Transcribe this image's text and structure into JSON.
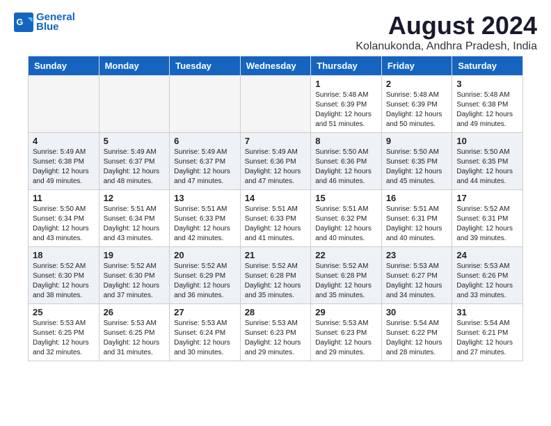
{
  "header": {
    "logo_line1": "General",
    "logo_line2": "Blue",
    "month_title": "August 2024",
    "location": "Kolanukonda, Andhra Pradesh, India"
  },
  "weekdays": [
    "Sunday",
    "Monday",
    "Tuesday",
    "Wednesday",
    "Thursday",
    "Friday",
    "Saturday"
  ],
  "weeks": [
    [
      {
        "day": "",
        "info": ""
      },
      {
        "day": "",
        "info": ""
      },
      {
        "day": "",
        "info": ""
      },
      {
        "day": "",
        "info": ""
      },
      {
        "day": "1",
        "info": "Sunrise: 5:48 AM\nSunset: 6:39 PM\nDaylight: 12 hours\nand 51 minutes."
      },
      {
        "day": "2",
        "info": "Sunrise: 5:48 AM\nSunset: 6:39 PM\nDaylight: 12 hours\nand 50 minutes."
      },
      {
        "day": "3",
        "info": "Sunrise: 5:48 AM\nSunset: 6:38 PM\nDaylight: 12 hours\nand 49 minutes."
      }
    ],
    [
      {
        "day": "4",
        "info": "Sunrise: 5:49 AM\nSunset: 6:38 PM\nDaylight: 12 hours\nand 49 minutes."
      },
      {
        "day": "5",
        "info": "Sunrise: 5:49 AM\nSunset: 6:37 PM\nDaylight: 12 hours\nand 48 minutes."
      },
      {
        "day": "6",
        "info": "Sunrise: 5:49 AM\nSunset: 6:37 PM\nDaylight: 12 hours\nand 47 minutes."
      },
      {
        "day": "7",
        "info": "Sunrise: 5:49 AM\nSunset: 6:36 PM\nDaylight: 12 hours\nand 47 minutes."
      },
      {
        "day": "8",
        "info": "Sunrise: 5:50 AM\nSunset: 6:36 PM\nDaylight: 12 hours\nand 46 minutes."
      },
      {
        "day": "9",
        "info": "Sunrise: 5:50 AM\nSunset: 6:35 PM\nDaylight: 12 hours\nand 45 minutes."
      },
      {
        "day": "10",
        "info": "Sunrise: 5:50 AM\nSunset: 6:35 PM\nDaylight: 12 hours\nand 44 minutes."
      }
    ],
    [
      {
        "day": "11",
        "info": "Sunrise: 5:50 AM\nSunset: 6:34 PM\nDaylight: 12 hours\nand 43 minutes."
      },
      {
        "day": "12",
        "info": "Sunrise: 5:51 AM\nSunset: 6:34 PM\nDaylight: 12 hours\nand 43 minutes."
      },
      {
        "day": "13",
        "info": "Sunrise: 5:51 AM\nSunset: 6:33 PM\nDaylight: 12 hours\nand 42 minutes."
      },
      {
        "day": "14",
        "info": "Sunrise: 5:51 AM\nSunset: 6:33 PM\nDaylight: 12 hours\nand 41 minutes."
      },
      {
        "day": "15",
        "info": "Sunrise: 5:51 AM\nSunset: 6:32 PM\nDaylight: 12 hours\nand 40 minutes."
      },
      {
        "day": "16",
        "info": "Sunrise: 5:51 AM\nSunset: 6:31 PM\nDaylight: 12 hours\nand 40 minutes."
      },
      {
        "day": "17",
        "info": "Sunrise: 5:52 AM\nSunset: 6:31 PM\nDaylight: 12 hours\nand 39 minutes."
      }
    ],
    [
      {
        "day": "18",
        "info": "Sunrise: 5:52 AM\nSunset: 6:30 PM\nDaylight: 12 hours\nand 38 minutes."
      },
      {
        "day": "19",
        "info": "Sunrise: 5:52 AM\nSunset: 6:30 PM\nDaylight: 12 hours\nand 37 minutes."
      },
      {
        "day": "20",
        "info": "Sunrise: 5:52 AM\nSunset: 6:29 PM\nDaylight: 12 hours\nand 36 minutes."
      },
      {
        "day": "21",
        "info": "Sunrise: 5:52 AM\nSunset: 6:28 PM\nDaylight: 12 hours\nand 35 minutes."
      },
      {
        "day": "22",
        "info": "Sunrise: 5:52 AM\nSunset: 6:28 PM\nDaylight: 12 hours\nand 35 minutes."
      },
      {
        "day": "23",
        "info": "Sunrise: 5:53 AM\nSunset: 6:27 PM\nDaylight: 12 hours\nand 34 minutes."
      },
      {
        "day": "24",
        "info": "Sunrise: 5:53 AM\nSunset: 6:26 PM\nDaylight: 12 hours\nand 33 minutes."
      }
    ],
    [
      {
        "day": "25",
        "info": "Sunrise: 5:53 AM\nSunset: 6:25 PM\nDaylight: 12 hours\nand 32 minutes."
      },
      {
        "day": "26",
        "info": "Sunrise: 5:53 AM\nSunset: 6:25 PM\nDaylight: 12 hours\nand 31 minutes."
      },
      {
        "day": "27",
        "info": "Sunrise: 5:53 AM\nSunset: 6:24 PM\nDaylight: 12 hours\nand 30 minutes."
      },
      {
        "day": "28",
        "info": "Sunrise: 5:53 AM\nSunset: 6:23 PM\nDaylight: 12 hours\nand 29 minutes."
      },
      {
        "day": "29",
        "info": "Sunrise: 5:53 AM\nSunset: 6:23 PM\nDaylight: 12 hours\nand 29 minutes."
      },
      {
        "day": "30",
        "info": "Sunrise: 5:54 AM\nSunset: 6:22 PM\nDaylight: 12 hours\nand 28 minutes."
      },
      {
        "day": "31",
        "info": "Sunrise: 5:54 AM\nSunset: 6:21 PM\nDaylight: 12 hours\nand 27 minutes."
      }
    ]
  ]
}
